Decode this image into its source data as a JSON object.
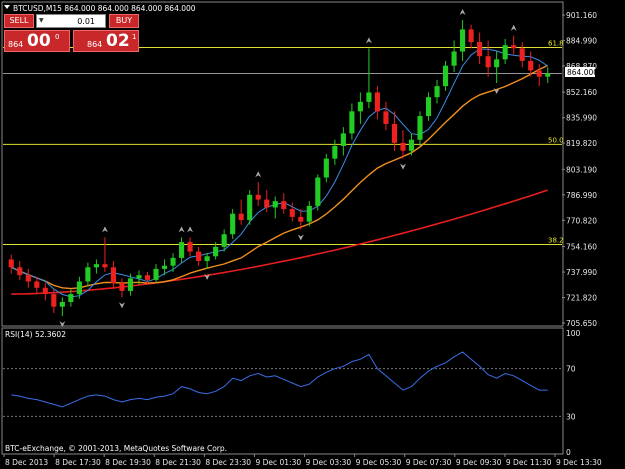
{
  "window": {
    "symbol_info": "BTCUSD,M15  864.000 864.000 864.000 864.000",
    "copyright": "BTC-eExchange, © 2001-2013, MetaQuotes Software Corp.",
    "current_price_label": "864.000"
  },
  "trade_panel": {
    "sell_label": "SELL",
    "buy_label": "BUY",
    "volume_value": "0.01",
    "sell_price_prefix": "864",
    "sell_price_big": "00",
    "sell_price_sup": "0",
    "buy_price_prefix": "864",
    "buy_price_big": "02",
    "buy_price_sup": "1"
  },
  "colors": {
    "background": "#000000",
    "bull_candle": "#22cc22",
    "bear_candle": "#ee2020",
    "ma_fast": "#3a8ee8",
    "ma_mid": "#f0901e",
    "ma_slow": "#e81e1e",
    "fib_level": "#e0e030",
    "rsi_line": "#3a6ee8"
  },
  "chart_data": {
    "type": "candlestick",
    "y_ticks": [
      "901.160",
      "884.990",
      "868.870",
      "852.160",
      "835.990",
      "819.820",
      "803.190",
      "786.990",
      "770.820",
      "754.160",
      "737.990",
      "721.820",
      "705.650"
    ],
    "ylim": [
      705.65,
      901.16
    ],
    "x_ticks": [
      "8 Dec 2013",
      "8 Dec 17:30",
      "8 Dec 19:30",
      "8 Dec 21:30",
      "8 Dec 23:30",
      "9 Dec 01:30",
      "9 Dec 03:30",
      "9 Dec 05:30",
      "9 Dec 07:30",
      "9 Dec 09:30",
      "9 Dec 11:30",
      "9 Dec 13:30"
    ],
    "fib_levels": [
      {
        "label": "61.8",
        "value": 880.5
      },
      {
        "label": "50.0",
        "value": 819.0
      },
      {
        "label": "38.2",
        "value": 755.5
      }
    ],
    "current_price": 864.0,
    "candles": [
      [
        746,
        749,
        737,
        741
      ],
      [
        741,
        745,
        733,
        736
      ],
      [
        736,
        740,
        728,
        732
      ],
      [
        732,
        735,
        724,
        728
      ],
      [
        728,
        731,
        720,
        724
      ],
      [
        724,
        727,
        712,
        716
      ],
      [
        716,
        722,
        710,
        719
      ],
      [
        719,
        727,
        716,
        724
      ],
      [
        724,
        735,
        721,
        732
      ],
      [
        732,
        744,
        729,
        741
      ],
      [
        741,
        746,
        737,
        743
      ],
      [
        743,
        760,
        738,
        741
      ],
      [
        741,
        745,
        728,
        731
      ],
      [
        731,
        734,
        722,
        726
      ],
      [
        726,
        737,
        723,
        734
      ],
      [
        734,
        739,
        730,
        736
      ],
      [
        736,
        738,
        730,
        733
      ],
      [
        733,
        743,
        731,
        740
      ],
      [
        740,
        746,
        736,
        742
      ],
      [
        742,
        750,
        738,
        747
      ],
      [
        747,
        760,
        744,
        757
      ],
      [
        757,
        760,
        748,
        751
      ],
      [
        751,
        754,
        742,
        745
      ],
      [
        745,
        750,
        740,
        748
      ],
      [
        748,
        757,
        746,
        754
      ],
      [
        754,
        765,
        751,
        762
      ],
      [
        762,
        778,
        759,
        775
      ],
      [
        775,
        784,
        768,
        771
      ],
      [
        771,
        790,
        768,
        787
      ],
      [
        787,
        795,
        780,
        784
      ],
      [
        784,
        790,
        776,
        779
      ],
      [
        779,
        786,
        772,
        783
      ],
      [
        783,
        788,
        775,
        778
      ],
      [
        778,
        782,
        770,
        773
      ],
      [
        773,
        778,
        765,
        770
      ],
      [
        770,
        783,
        767,
        780
      ],
      [
        780,
        800,
        777,
        798
      ],
      [
        798,
        813,
        795,
        810
      ],
      [
        810,
        822,
        806,
        818
      ],
      [
        818,
        830,
        812,
        826
      ],
      [
        826,
        845,
        822,
        840
      ],
      [
        840,
        852,
        832,
        846
      ],
      [
        846,
        880,
        842,
        852
      ],
      [
        852,
        856,
        835,
        840
      ],
      [
        840,
        846,
        828,
        832
      ],
      [
        832,
        840,
        815,
        820
      ],
      [
        820,
        828,
        810,
        815
      ],
      [
        815,
        826,
        812,
        822
      ],
      [
        822,
        840,
        818,
        837
      ],
      [
        837,
        852,
        834,
        849
      ],
      [
        849,
        860,
        845,
        856
      ],
      [
        856,
        872,
        853,
        869
      ],
      [
        869,
        885,
        865,
        878
      ],
      [
        878,
        898,
        872,
        892
      ],
      [
        892,
        895,
        880,
        884
      ],
      [
        884,
        890,
        870,
        875
      ],
      [
        875,
        885,
        862,
        868
      ],
      [
        868,
        878,
        858,
        873
      ],
      [
        873,
        886,
        870,
        882
      ],
      [
        882,
        888,
        876,
        880
      ],
      [
        880,
        884,
        868,
        872
      ],
      [
        872,
        878,
        862,
        866
      ],
      [
        866,
        870,
        856,
        862
      ],
      [
        862,
        868,
        858,
        864
      ]
    ],
    "rsi": {
      "label": "RSI(14) 52.3602",
      "levels": [
        "100",
        "70",
        "30",
        "0"
      ],
      "values": [
        48,
        47,
        45,
        44,
        42,
        40,
        38,
        41,
        44,
        47,
        48,
        47,
        44,
        42,
        44,
        45,
        44,
        46,
        47,
        49,
        55,
        53,
        50,
        49,
        51,
        55,
        62,
        60,
        64,
        66,
        63,
        64,
        61,
        58,
        55,
        57,
        63,
        67,
        70,
        72,
        76,
        78,
        82,
        70,
        64,
        58,
        52,
        55,
        62,
        68,
        72,
        75,
        80,
        84,
        78,
        72,
        65,
        62,
        66,
        64,
        60,
        56,
        52,
        52
      ]
    }
  }
}
